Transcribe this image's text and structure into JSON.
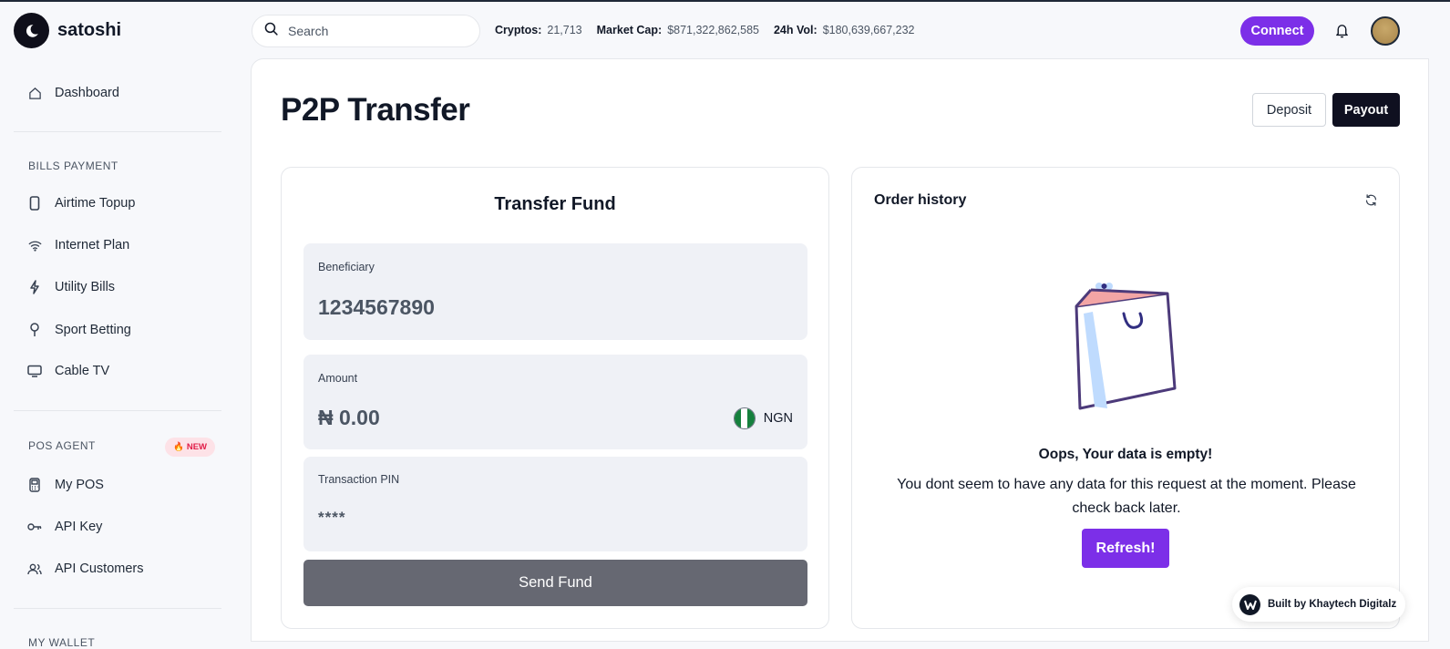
{
  "brand": {
    "name": "satoshi"
  },
  "sidebar": {
    "dashboard": "Dashboard",
    "bills_section": "BILLS PAYMENT",
    "bills_items": [
      "Airtime Topup",
      "Internet Plan",
      "Utility Bills",
      "Sport Betting",
      "Cable TV"
    ],
    "pos_section": "POS AGENT",
    "pos_badge": "NEW",
    "pos_items": [
      "My POS",
      "API Key",
      "API Customers"
    ],
    "wallet_section": "MY WALLET"
  },
  "topbar": {
    "search_placeholder": "Search",
    "stats": [
      {
        "label": "Cryptos:",
        "value": "21,713"
      },
      {
        "label": "Market Cap:",
        "value": "$871,322,862,585"
      },
      {
        "label": "24h Vol:",
        "value": "$180,639,667,232"
      }
    ],
    "connect_label": "Connect"
  },
  "page": {
    "title": "P2P Transfer",
    "deposit_label": "Deposit",
    "payout_label": "Payout"
  },
  "transfer": {
    "title": "Transfer Fund",
    "beneficiary_label": "Beneficiary",
    "beneficiary_value": "1234567890",
    "amount_label": "Amount",
    "amount_value": "₦ 0.00",
    "currency": "NGN",
    "pin_label": "Transaction PIN",
    "pin_value": "****",
    "send_label": "Send Fund"
  },
  "orders": {
    "title": "Order history",
    "empty_title": "Oops, Your data is empty!",
    "empty_desc": "You dont seem to have any data for this request at the moment. Please check back later.",
    "refresh_label": "Refresh!"
  },
  "footer_badge": "Built by Khaytech Digitalz",
  "colors": {
    "accent": "#7c2fe8",
    "dark": "#0f1020",
    "send_button": "#666872",
    "flag_green": "#15803d"
  }
}
